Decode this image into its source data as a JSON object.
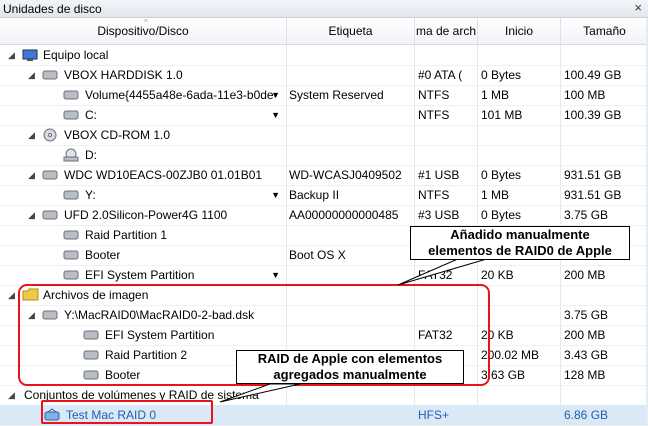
{
  "window": {
    "title": "Unidades de disco",
    "close_glyph": "×"
  },
  "columns": [
    "Dispositivo/Disco",
    "Etiqueta",
    "ma de arch",
    "Inicio",
    "Tamaño"
  ],
  "rows": [
    {
      "name": "Equipo local",
      "label": "",
      "fs": "",
      "start": "",
      "size": ""
    },
    {
      "name": "VBOX HARDDISK 1.0",
      "label": "",
      "fs": "#0 ATA (",
      "start": "0 Bytes",
      "size": "100.49 GB"
    },
    {
      "name": "Volume{4455a48e-6ada-11e3-b0de-",
      "label": "System Reserved",
      "fs": "NTFS",
      "start": "1 MB",
      "size": "100 MB"
    },
    {
      "name": "C:",
      "label": "",
      "fs": "NTFS",
      "start": "101 MB",
      "size": "100.39 GB"
    },
    {
      "name": "VBOX CD-ROM 1.0",
      "label": "",
      "fs": "",
      "start": "",
      "size": ""
    },
    {
      "name": "D:",
      "label": "",
      "fs": "",
      "start": "",
      "size": ""
    },
    {
      "name": "WDC WD10EACS-00ZJB0 01.01B01",
      "label": "WD-WCASJ0409502",
      "fs": "#1 USB",
      "start": "0 Bytes",
      "size": "931.51 GB"
    },
    {
      "name": "Y:",
      "label": "Backup II",
      "fs": "NTFS",
      "start": "1 MB",
      "size": "931.51 GB"
    },
    {
      "name": "UFD 2.0Silicon-Power4G 1100",
      "label": "AA00000000000485",
      "fs": "#3 USB",
      "start": "0 Bytes",
      "size": "3.75 GB"
    },
    {
      "name": "Raid Partition 1",
      "label": "",
      "fs": "",
      "start": "",
      "size": ""
    },
    {
      "name": "Booter",
      "label": "Boot OS X",
      "fs": "",
      "start": "",
      "size": ""
    },
    {
      "name": "EFI System Partition",
      "label": "",
      "fs": "FAT32",
      "start": "20 KB",
      "size": "200 MB"
    },
    {
      "name": "Archivos de imagen",
      "label": "",
      "fs": "",
      "start": "",
      "size": ""
    },
    {
      "name": "Y:\\MacRAID0\\MacRAID0-2-bad.dsk",
      "label": "",
      "fs": "",
      "start": "",
      "size": "3.75 GB"
    },
    {
      "name": "EFI System Partition",
      "label": "",
      "fs": "FAT32",
      "start": "20 KB",
      "size": "200 MB"
    },
    {
      "name": "Raid Partition 2",
      "label": "",
      "fs": "",
      "start": "200.02 MB",
      "size": "3.43 GB"
    },
    {
      "name": "Booter",
      "label": "",
      "fs": "",
      "start": "3.63 GB",
      "size": "128 MB"
    },
    {
      "name": "Conjuntos de volúmenes y RAID de sistema",
      "label": "",
      "fs": "",
      "start": "",
      "size": ""
    },
    {
      "name": "Test Mac RAID 0",
      "label": "",
      "fs": "HFS+",
      "start": "",
      "size": "6.86 GB"
    }
  ],
  "annotations": {
    "added_manually": "Añadido manualmente\nelementos de RAID0 de Apple",
    "apple_raid": "RAID de Apple con elementos\nagregados manualmente"
  },
  "colors": {
    "callout": "#e8141b",
    "selection": "#dbe8f6",
    "raid_text": "#1f5fb4"
  }
}
